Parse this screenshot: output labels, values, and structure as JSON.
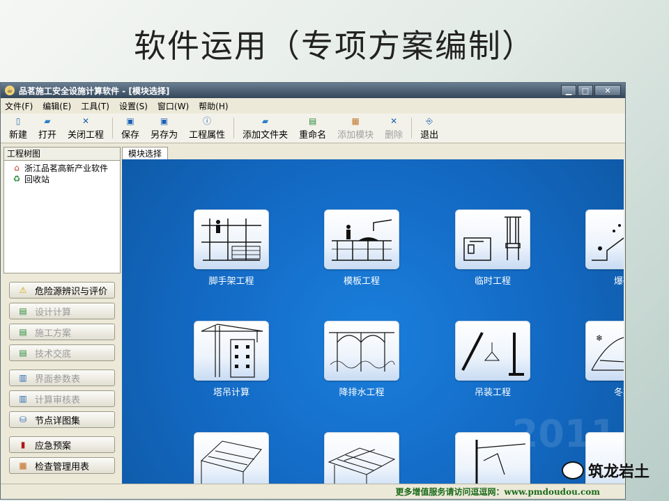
{
  "slide": {
    "title": "软件运用（专项方案编制）"
  },
  "window": {
    "title": "品茗施工安全设施计算软件 - [模块选择]",
    "controls": {
      "minimize": "▁",
      "maximize": "□",
      "close": "✕"
    }
  },
  "menubar": {
    "items": [
      "文件(F)",
      "编辑(E)",
      "工具(T)",
      "设置(S)",
      "窗口(W)",
      "帮助(H)"
    ]
  },
  "toolbar": {
    "new": "新建",
    "open": "打开",
    "close_project": "关闭工程",
    "save": "保存",
    "save_as": "另存为",
    "project_props": "工程属性",
    "add_folder": "添加文件夹",
    "rename": "重命名",
    "add_module": "添加模块",
    "delete": "删除",
    "exit": "退出"
  },
  "left_panel": {
    "header": "工程树图",
    "tree": [
      "浙江品茗高新产业软件",
      "回收站"
    ],
    "buttons": {
      "hazard": "危险源辨识与评价",
      "design_calc": "设计计算",
      "construction_plan": "施工方案",
      "tech_brief": "技术交底",
      "param_table": "界面参数表",
      "calc_review": "计算审核表",
      "node_detail": "节点详图集",
      "emergency": "应急预案",
      "inspection": "检查管理用表"
    }
  },
  "tabs": {
    "module_select": "模块选择"
  },
  "modules": {
    "scaffold": "脚手架工程",
    "formwork": "模板工程",
    "temporary": "临时工程",
    "blasting": "爆破",
    "tower_crane": "塔吊计算",
    "dewatering": "降排水工程",
    "hoisting": "吊装工程",
    "winter": "冬期"
  },
  "watermark": "2011",
  "statusbar": {
    "text": "更多增值服务请访问逗逗网：www.pmdoudou.com"
  },
  "brand": {
    "text": "筑龙岩土"
  }
}
